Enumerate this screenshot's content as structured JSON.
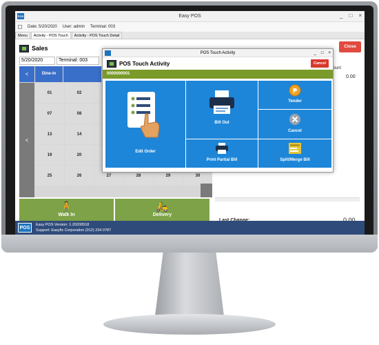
{
  "window": {
    "title": "Easy POS",
    "app_icon": "POS",
    "minimize": "_",
    "maximize": "□",
    "close": "×"
  },
  "info": {
    "date": "Date: 5/20/2020",
    "user": "User: admin",
    "terminal": "Terminal: 003"
  },
  "tabs": [
    "Menu",
    "Activity - POS Touch",
    "Activity - POS Touch Detail"
  ],
  "sales": {
    "title": "Sales",
    "close_label": "Close",
    "date_value": "5/20/2020",
    "terminal_value": "Terminal: 003",
    "nav_prev": "<",
    "nav_left": "<",
    "dine_in": "Dine-in",
    "tables": [
      "01",
      "02",
      "",
      "",
      "",
      "",
      "07",
      "08",
      "",
      "",
      "",
      "",
      "13",
      "14",
      "",
      "",
      "",
      "",
      "19",
      "20",
      "",
      "",
      "",
      "",
      "25",
      "26",
      "27",
      "28",
      "29",
      "30"
    ],
    "walk_in": "Walk In",
    "delivery": "Delivery",
    "amount_header": "nount",
    "amount_value": "0.00",
    "last_change_label": "Last Change:",
    "last_change_value": "0.00"
  },
  "status": {
    "logo": "POS",
    "version": "Easy POS Version: 1.20200518",
    "support": "Support: Easyfis Corporation (012) 234 0787"
  },
  "modal": {
    "title": "POS Touch Activity",
    "header": "POS Touch Activity",
    "cancel": "Cancel",
    "order_no": "0000000001",
    "tiles": {
      "edit_order": "Edit Order",
      "bill_out": "Bill Out",
      "print_partial": "Print Partial Bill",
      "tender": "Tender",
      "cancel": "Cancel",
      "split": "Split/Merge Bill"
    }
  },
  "colors": {
    "accent_blue": "#1e86d8",
    "green": "#7da247",
    "red": "#e04a3f",
    "status_bar": "#2f4b7a"
  }
}
